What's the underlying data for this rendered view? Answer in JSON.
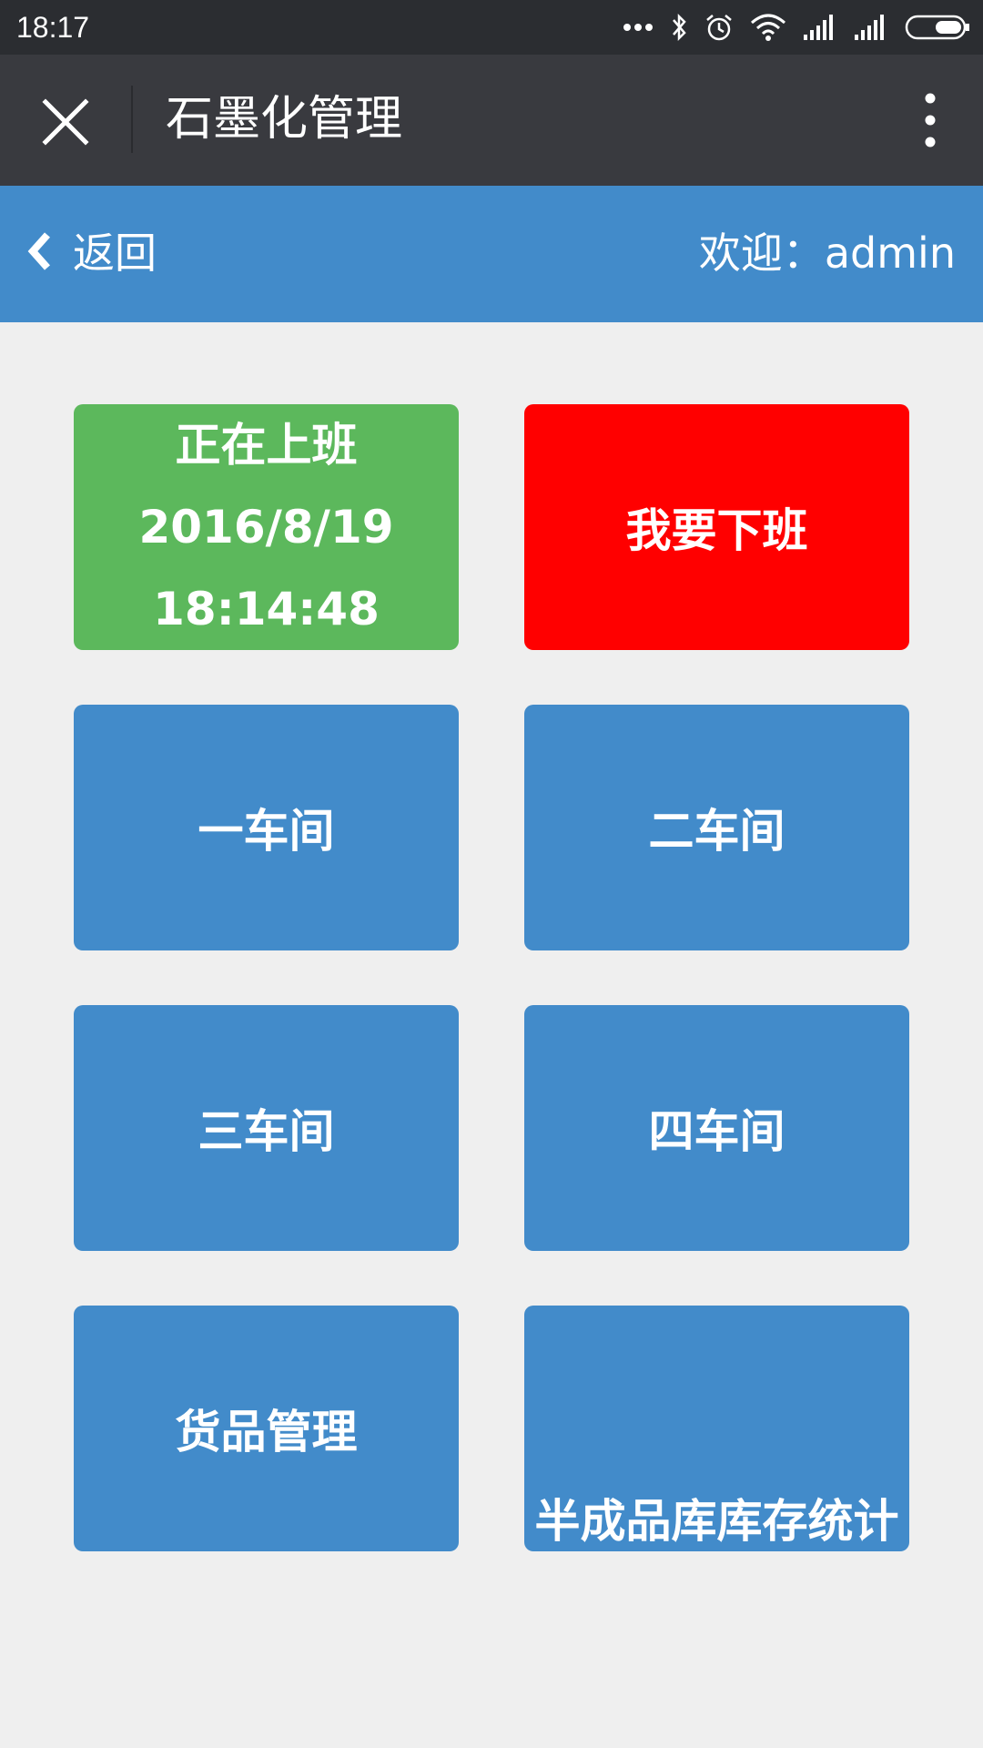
{
  "status_bar": {
    "time": "18:17",
    "icons": [
      "more-dots-icon",
      "bluetooth-icon",
      "alarm-icon",
      "wifi-icon",
      "signal-icon",
      "signal-icon",
      "battery-icon"
    ]
  },
  "wechat_bar": {
    "title": "石墨化管理",
    "background": "#393a3f"
  },
  "header": {
    "back_label": "返回",
    "welcome": "欢迎：admin",
    "background": "#428bca"
  },
  "tiles": {
    "on_duty": {
      "status": "正在上班",
      "date": "2016/8/19",
      "time": "18:14:48",
      "color": "#5cb85c"
    },
    "off_duty": {
      "label": "我要下班",
      "color": "#ff0000"
    },
    "workshop_1": "一车间",
    "workshop_2": "二车间",
    "workshop_3": "三车间",
    "workshop_4": "四车间",
    "goods_management": "货品管理",
    "semi_finished_stats": "半成品库库存统计",
    "tile_color": "#428bca"
  }
}
